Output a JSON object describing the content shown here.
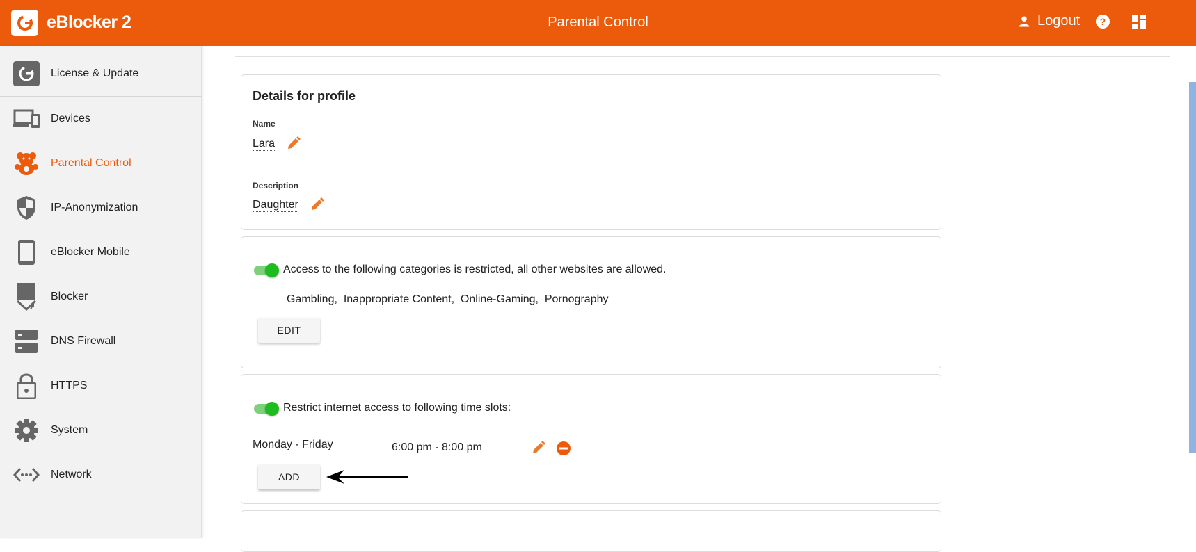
{
  "header": {
    "app_title": "eBlocker 2",
    "page_title": "Parental Control",
    "logout_label": "Logout",
    "logo_icon": "eblocker-logo-icon",
    "help_icon": "help-circle-icon",
    "dashboard_icon": "dashboard-icon",
    "accent_color": "#ec5b0c"
  },
  "sidebar": {
    "items": [
      {
        "label": "License & Update",
        "icon": "license-update-icon"
      },
      {
        "label": "Devices",
        "icon": "devices-icon"
      },
      {
        "label": "Parental Control",
        "icon": "teddy-bear-icon",
        "active": true
      },
      {
        "label": "IP-Anonymization",
        "icon": "shield-icon"
      },
      {
        "label": "eBlocker Mobile",
        "icon": "phone-icon"
      },
      {
        "label": "Blocker",
        "icon": "blocker-icon"
      },
      {
        "label": "DNS Firewall",
        "icon": "dns-icon"
      },
      {
        "label": "HTTPS",
        "icon": "lock-icon"
      },
      {
        "label": "System",
        "icon": "gear-icon"
      },
      {
        "label": "Network",
        "icon": "network-icon"
      }
    ]
  },
  "profile": {
    "title": "Details for profile",
    "name_label": "Name",
    "name_value": "Lara",
    "description_label": "Description",
    "description_value": "Daughter"
  },
  "categories_card": {
    "enabled": true,
    "text": "Access to the following categories is restricted, all other websites are allowed.",
    "categories": "Gambling,  Inappropriate Content,  Online-Gaming,  Pornography",
    "edit_label": "EDIT"
  },
  "time_card": {
    "enabled": true,
    "text": "Restrict internet access to following time slots:",
    "slots": [
      {
        "days": "Monday - Friday",
        "time": "6:00 pm - 8:00 pm"
      }
    ],
    "add_label": "ADD"
  }
}
